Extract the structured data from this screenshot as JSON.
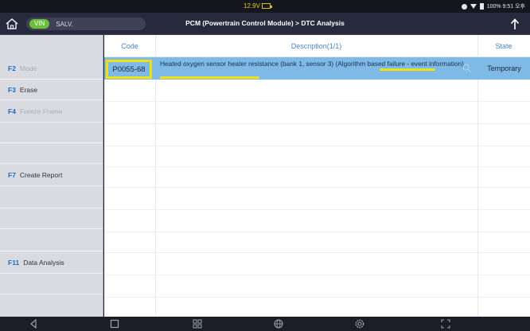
{
  "status_bar": {
    "voltage": "12.9V",
    "system_info": "100% 9:51 오후"
  },
  "header": {
    "vin_label": "VIN",
    "salv_label": "SALV.",
    "title": "PCM (Powertrain Control Module) > DTC Analysis"
  },
  "sidebar": {
    "items": [
      {
        "key": "F2",
        "label": "Mode",
        "enabled": false
      },
      {
        "key": "F3",
        "label": "Erase",
        "enabled": true
      },
      {
        "key": "F4",
        "label": "Freeze Frame",
        "enabled": false
      },
      {
        "key": "",
        "label": "",
        "enabled": false
      },
      {
        "key": "",
        "label": "",
        "enabled": false
      },
      {
        "key": "F7",
        "label": "Create Report",
        "enabled": true
      },
      {
        "key": "",
        "label": "",
        "enabled": false
      },
      {
        "key": "",
        "label": "",
        "enabled": false
      },
      {
        "key": "",
        "label": "",
        "enabled": false
      },
      {
        "key": "F11",
        "label": "Data Analysis",
        "enabled": true
      }
    ]
  },
  "table": {
    "columns": [
      "Code",
      "Description(1/1)",
      "State"
    ],
    "rows": [
      {
        "code": "P0055-68",
        "description": "Heated oxygen sensor heater resistance (bank 1, sensor 3) (Algorithm based failure - event information)",
        "state": "Temporary"
      }
    ]
  },
  "colors": {
    "highlight_box": "#f1e20d",
    "selected_row": "#7fb9e5",
    "accent": "#4a84c8",
    "vin_badge": "#6cbf3a"
  },
  "icons": {
    "status_bar": [
      "battery-icon",
      "wifi-icon",
      "notification-icon"
    ],
    "title_bar": [
      "home-icon",
      "export-icon"
    ],
    "row": [
      "search-icon"
    ],
    "nav": [
      "back-icon",
      "recent-apps-icon",
      "grid-icon",
      "globe-icon",
      "settings-icon",
      "fullscreen-icon"
    ]
  }
}
